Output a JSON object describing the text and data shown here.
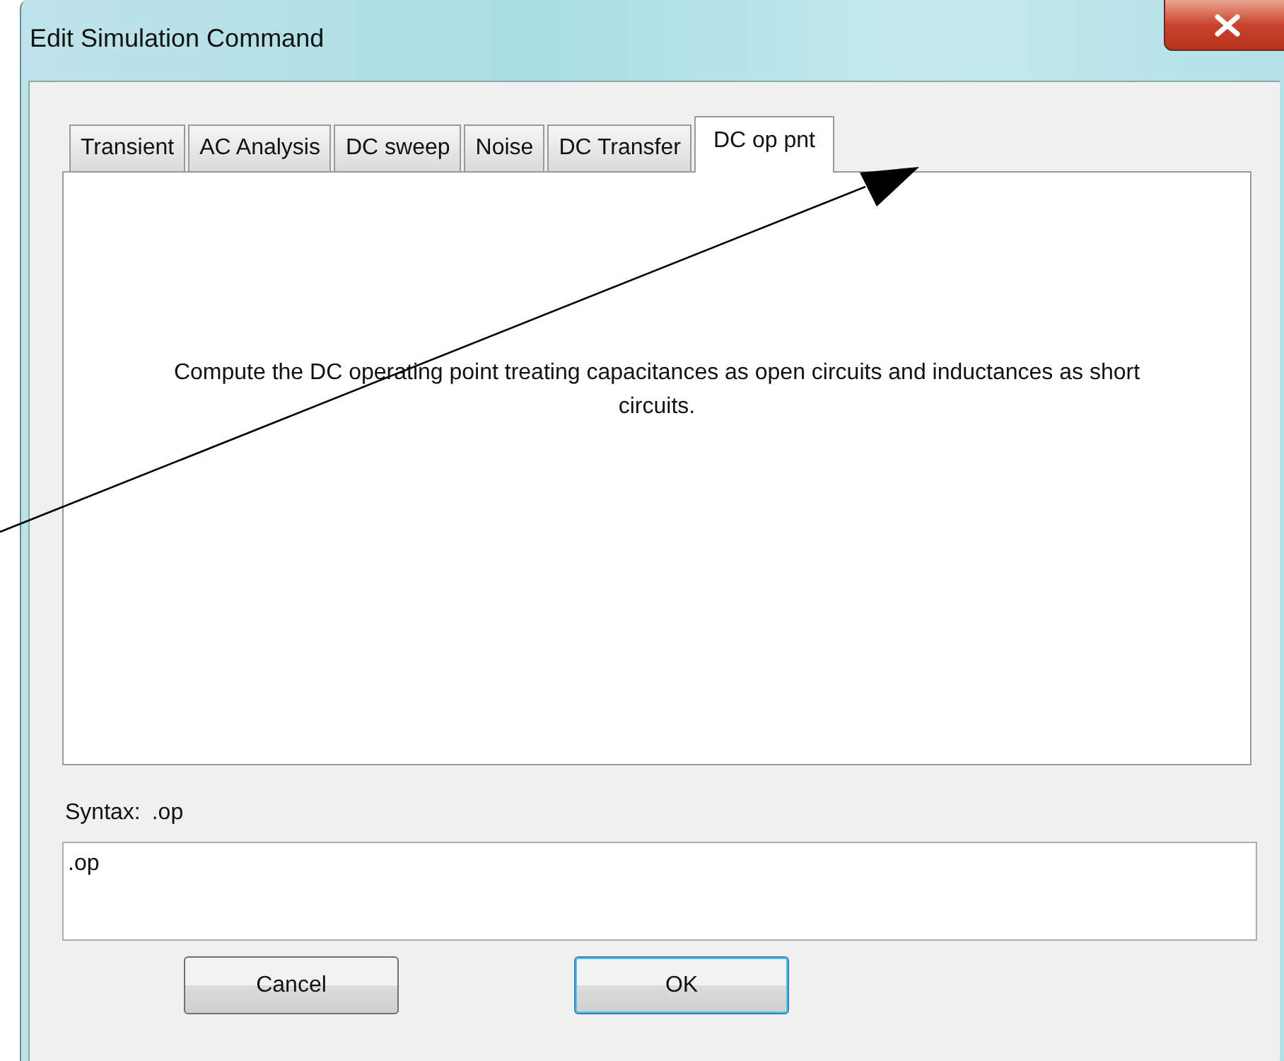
{
  "window": {
    "title": "Edit Simulation Command"
  },
  "tabs": [
    {
      "label": "Transient",
      "selected": false
    },
    {
      "label": "AC Analysis",
      "selected": false
    },
    {
      "label": "DC sweep",
      "selected": false
    },
    {
      "label": "Noise",
      "selected": false
    },
    {
      "label": "DC Transfer",
      "selected": false
    },
    {
      "label": "DC op pnt",
      "selected": true
    }
  ],
  "panel": {
    "description": "Compute the DC operating point treating capacitances as open circuits and inductances as short circuits."
  },
  "syntax": {
    "label": "Syntax:",
    "value": ".op"
  },
  "command": {
    "value": ".op"
  },
  "buttons": [
    {
      "label": "Cancel",
      "default": false
    },
    {
      "label": "OK",
      "default": true
    }
  ]
}
